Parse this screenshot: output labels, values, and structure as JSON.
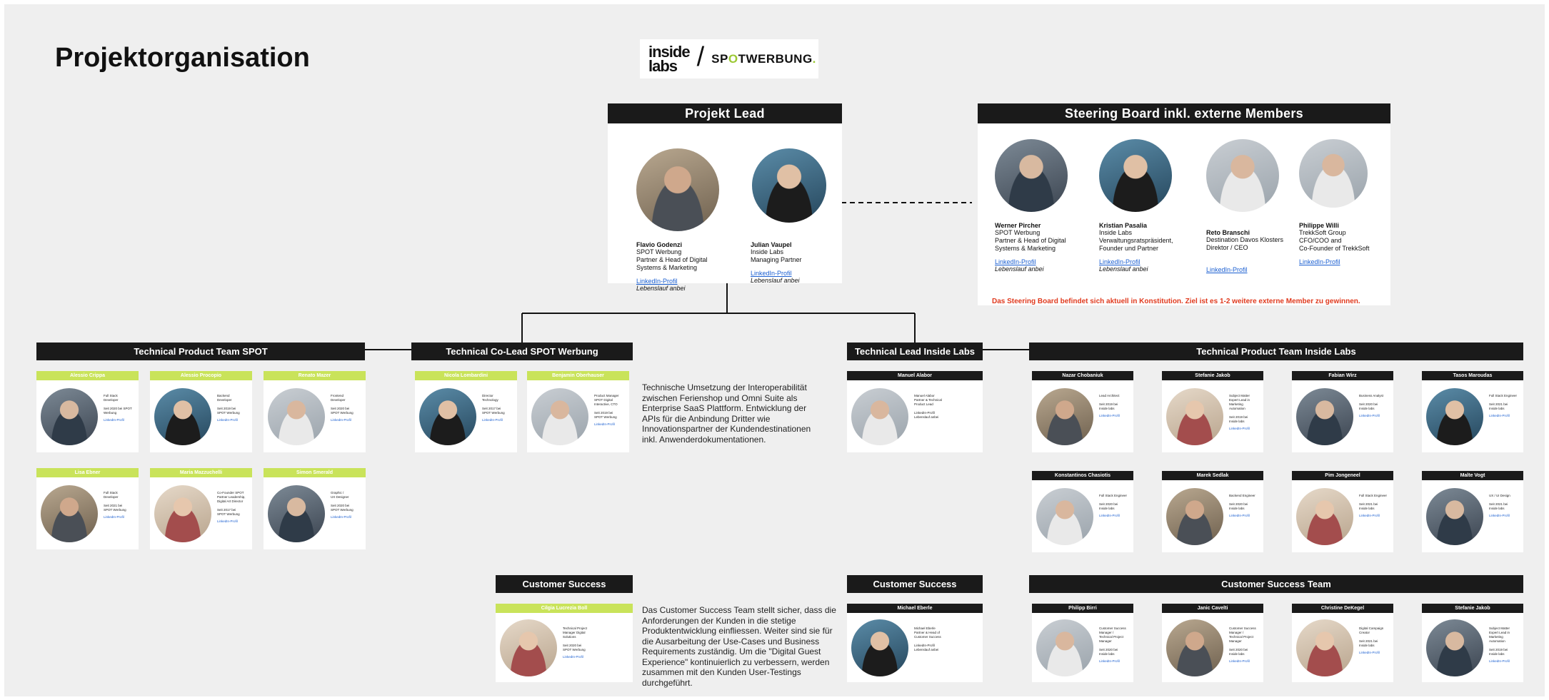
{
  "page_title": "Projektorganisation",
  "logo": {
    "inside": "inside labs",
    "spot_pre": "SP",
    "spot_o": "O",
    "spot_post": "TWERBUNG",
    "spot_dot": "."
  },
  "projekt_lead": {
    "title": "Projekt Lead",
    "people": [
      {
        "name": "Flavio Godenzi",
        "lines": [
          "SPOT Werbung",
          "Partner & Head of Digital",
          "Systems & Marketing"
        ],
        "link": "LinkedIn-Profil",
        "cv": "Lebenslauf anbei"
      },
      {
        "name": "Julian Vaupel",
        "lines": [
          "Inside Labs",
          "Managing Partner"
        ],
        "link": "LinkedIn-Profil",
        "cv": "Lebenslauf anbei"
      }
    ]
  },
  "steering": {
    "title": "Steering Board inkl. externe Members",
    "people": [
      {
        "name": "Werner Pircher",
        "lines": [
          "SPOT Werbung",
          "Partner & Head of Digital",
          "Systems & Marketing"
        ],
        "link": "LinkedIn-Profil",
        "cv": "Lebenslauf anbei"
      },
      {
        "name": "Kristian Pasalia",
        "lines": [
          "Inside Labs",
          "Verwaltungsratspräsident,",
          "Founder und Partner"
        ],
        "link": "LinkedIn-Profil",
        "cv": "Lebenslauf anbei"
      },
      {
        "name": "Reto Branschi",
        "lines": [
          "Destination Davos Klosters",
          "Direktor / CEO"
        ],
        "link": "LinkedIn-Profil",
        "cv": ""
      },
      {
        "name": "Philippe Willi",
        "lines": [
          "TrekkSoft Group",
          "CFO/COO and",
          "Co-Founder of TrekkSoft"
        ],
        "link": "LinkedIn-Profil",
        "cv": ""
      }
    ],
    "note": "Das Steering Board befindet sich aktuell in Konstitution. Ziel ist es 1-2 weitere externe Member zu gewinnen."
  },
  "tech_spot": {
    "title": "Technical Product Team SPOT",
    "members": [
      {
        "name": "Alessio Crippa",
        "info": [
          "Full Stack",
          "Developer",
          "",
          "Seit 2020 bei SPOT",
          "Werbung"
        ]
      },
      {
        "name": "Alessio Procopio",
        "info": [
          "Backend",
          "Developer",
          "",
          "Seit 2019 bei",
          "SPOT Werbung"
        ]
      },
      {
        "name": "Renato Mazer",
        "info": [
          "Frontend",
          "Developer",
          "",
          "Seit 2020 bei",
          "SPOT Werbung"
        ]
      },
      {
        "name": "Lisa Ebner",
        "info": [
          "Full Stack",
          "Developer",
          "",
          "Seit 2021 bei",
          "SPOT Werbung"
        ]
      },
      {
        "name": "Maria Mazzuchelli",
        "info": [
          "Co-Founder SPOT",
          "Partner Leadership,",
          "Digital Art Director",
          "",
          "Seit 2017 bei",
          "SPOT Werbung"
        ]
      },
      {
        "name": "Simon Smerald",
        "info": [
          "Graphic /",
          "UX Designer",
          "",
          "Seit 2020 bei",
          "SPOT Werbung"
        ]
      }
    ],
    "link": "LinkedIn-Profil"
  },
  "co_lead": {
    "title": "Technical Co-Lead SPOT Werbung",
    "members": [
      {
        "name": "Nicola Lombardini",
        "info": [
          "Director",
          "Technology",
          "",
          "Seit 2017 bei",
          "SPOT Werbung"
        ]
      },
      {
        "name": "Benjamin Oberhauser",
        "info": [
          "Product Manager",
          "SPOT Digital",
          "Interactive, CTO",
          "",
          "Seit 2019 bei",
          "SPOT Werbung"
        ]
      }
    ],
    "desc": "Technische Umsetzung der Interoperabilität zwischen Ferienshop und Omni Suite als Enterprise SaaS Plattform. Entwicklung der APIs für die Anbindung Dritter wie Innovationspartner der Kundendestinationen inkl. Anwenderdokumentationen."
  },
  "lead_inside": {
    "title": "Technical Lead Inside Labs",
    "member": {
      "name": "Manuel Alabor",
      "info": [
        "Manuel Alabor",
        "Partner & Technical",
        "Product Lead",
        "",
        "LinkedIn-Profil",
        "Lebenslauf anbei"
      ]
    }
  },
  "tech_inside": {
    "title": "Technical Product Team Inside Labs",
    "members": [
      {
        "name": "Nazar Chobaniuk",
        "info": [
          "Lead Architect",
          "",
          "Seit 2019 bei",
          "Inside labs"
        ]
      },
      {
        "name": "Stefanie Jakob",
        "info": [
          "Subject Matter",
          "Expert Lead in",
          "Marketing",
          "Automation",
          "",
          "Seit 2019 bei",
          "Inside labs"
        ]
      },
      {
        "name": "Fabian Wirz",
        "info": [
          "Business Analyst",
          "",
          "Seit 2020 bei",
          "Inside labs"
        ]
      },
      {
        "name": "Tasos Maroudas",
        "info": [
          "Full Stack Engineer",
          "",
          "Seit 2021 bei",
          "Inside labs"
        ]
      },
      {
        "name": "Konstantinos Chasiotis",
        "info": [
          "Full Stack Engineer",
          "",
          "Seit 2020 bei",
          "Inside labs"
        ]
      },
      {
        "name": "Marek Sedlak",
        "info": [
          "Backend Engineer",
          "",
          "Seit 2020 bei",
          "Inside labs"
        ]
      },
      {
        "name": "Pim Jongeneel",
        "info": [
          "Full Stack Engineer",
          "",
          "Seit 2021 bei",
          "Inside labs"
        ]
      },
      {
        "name": "Malte Vogt",
        "info": [
          "UX / UI Design",
          "",
          "Seit 2021 bei",
          "Inside labs"
        ]
      }
    ],
    "link": "LinkedIn-Profil"
  },
  "cs_spot": {
    "title": "Customer Success",
    "member": {
      "name": "Cilgia Lucrezia Boll",
      "info": [
        "Technical Project",
        "Manager Digital",
        "Solutions",
        "",
        "Seit 2020 bei",
        "SPOT Werbung"
      ]
    },
    "desc": "Das Customer Success Team stellt sicher, dass die Anforderungen der Kunden in die stetige Produktentwicklung einfliessen. Weiter sind sie für die Ausarbeitung der Use-Cases und Business Requirements zuständig. Um die \"Digital Guest Experience\" kontinuierlich zu verbessern, werden zusammen mit den Kunden User-Testings durchgeführt."
  },
  "cs_inside": {
    "title": "Customer Success",
    "member": {
      "name": "Michael Eberle",
      "info": [
        "Michael Eberle",
        "Partner & Head of",
        "Customer Success",
        "",
        "LinkedIn-Profil",
        "Lebenslauf anbei"
      ]
    }
  },
  "cs_team": {
    "title": "Customer Success Team",
    "members": [
      {
        "name": "Philipp Birri",
        "info": [
          "Customer Success",
          "Manager /",
          "Technical Project",
          "Manager",
          "",
          "Seit 2020 bei",
          "Inside labs"
        ]
      },
      {
        "name": "Janic Cavelti",
        "info": [
          "Customer Success",
          "Manager /",
          "Technical Project",
          "Manager",
          "",
          "Seit 2020 bei",
          "Inside labs"
        ]
      },
      {
        "name": "Christine DeKegel",
        "info": [
          "Digital Campaign",
          "Creator",
          "",
          "Seit 2021 bei",
          "Inside labs"
        ]
      },
      {
        "name": "Stefanie Jakob",
        "info": [
          "Subject Matter",
          "Expert Lead in",
          "Marketing",
          "Automation",
          "",
          "Seit 2019 bei",
          "Inside labs"
        ]
      }
    ],
    "link": "LinkedIn-Profil"
  }
}
